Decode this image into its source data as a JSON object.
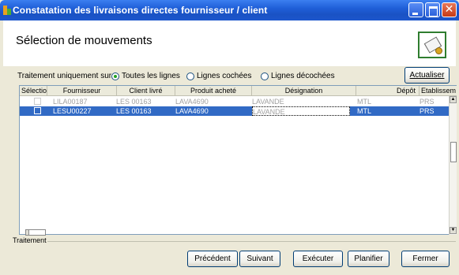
{
  "window": {
    "title": "Constatation des livraisons directes fournisseur / client"
  },
  "header": {
    "title": "Sélection de mouvements"
  },
  "filter": {
    "label": "Traitement uniquement sur :",
    "options": [
      "Toutes les lignes",
      "Lignes cochées",
      "Lignes décochées"
    ],
    "selected": "Toutes les lignes"
  },
  "refresh_label": "Actualiser",
  "grid": {
    "columns": [
      "Sélection",
      "Fournisseur",
      "Client livré",
      "Produit acheté",
      "Désignation",
      "Dépôt",
      "Etablissem"
    ],
    "rows": [
      {
        "selected": false,
        "fournisseur": "LILA00187",
        "client": "LES 00163",
        "produit": "LAVA4690",
        "designation": "LAVANDE",
        "depot": "MTL",
        "etab": "PRS"
      },
      {
        "selected": false,
        "fournisseur": "LESU00227",
        "client": "LES 00163",
        "produit": "LAVA4690",
        "designation": "LAVANDE",
        "depot": "MTL",
        "etab": "PRS"
      }
    ]
  },
  "footer": {
    "group_label": "Traitement",
    "buttons": {
      "prev": "Précédent",
      "next": "Suivant",
      "run": "Exécuter",
      "plan": "Planifier",
      "close": "Fermer"
    }
  }
}
